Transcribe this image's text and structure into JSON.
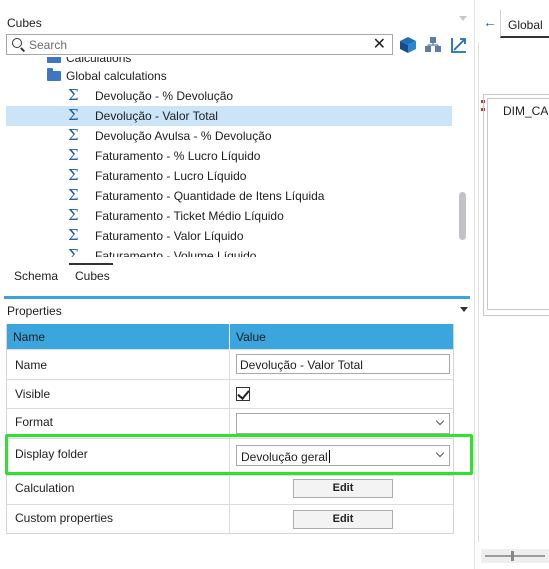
{
  "cubes_panel": {
    "title": "Cubes",
    "search_placeholder": "Search",
    "clear_glyph": "✕",
    "toolbar_icons": [
      "cube-icon",
      "hierarchy-icon",
      "axis-icon"
    ],
    "tree": {
      "partial_top_label": "Calculations",
      "folder_label": "Global calculations",
      "items": [
        "Devolução - % Devolução",
        "Devolução - Valor Total",
        "Devolução Avulsa - % Devolução",
        "Faturamento - % Lucro Líquido",
        "Faturamento - Lucro Líquido",
        "Faturamento - Quantidade de Itens Líquida",
        "Faturamento - Ticket Médio Líquido",
        "Faturamento - Valor Líquido",
        "Faturamento - Volume Líquido"
      ],
      "selected_item": "Devolução - Valor Total"
    },
    "tabs": [
      "Schema",
      "Cubes"
    ],
    "active_tab": "Cubes"
  },
  "properties": {
    "title": "Properties",
    "headers": {
      "name": "Name",
      "value": "Value"
    },
    "rows": {
      "name": {
        "label": "Name",
        "value": "Devolução - Valor Total"
      },
      "visible": {
        "label": "Visible",
        "checked": true
      },
      "format": {
        "label": "Format",
        "value": ""
      },
      "display_folder": {
        "label": "Display folder",
        "value": "Devolução geral"
      },
      "calculation": {
        "label": "Calculation",
        "button": "Edit"
      },
      "custom_properties": {
        "label": "Custom properties",
        "button": "Edit"
      }
    }
  },
  "right_panel": {
    "back_glyph": "←",
    "tab_label": "Global",
    "table_name": "DIM_CART"
  },
  "colors": {
    "accent": "#3aa6dd",
    "selection": "#cce4f7",
    "highlight": "#2ee22e",
    "icon_blue": "#1f5fa8"
  }
}
